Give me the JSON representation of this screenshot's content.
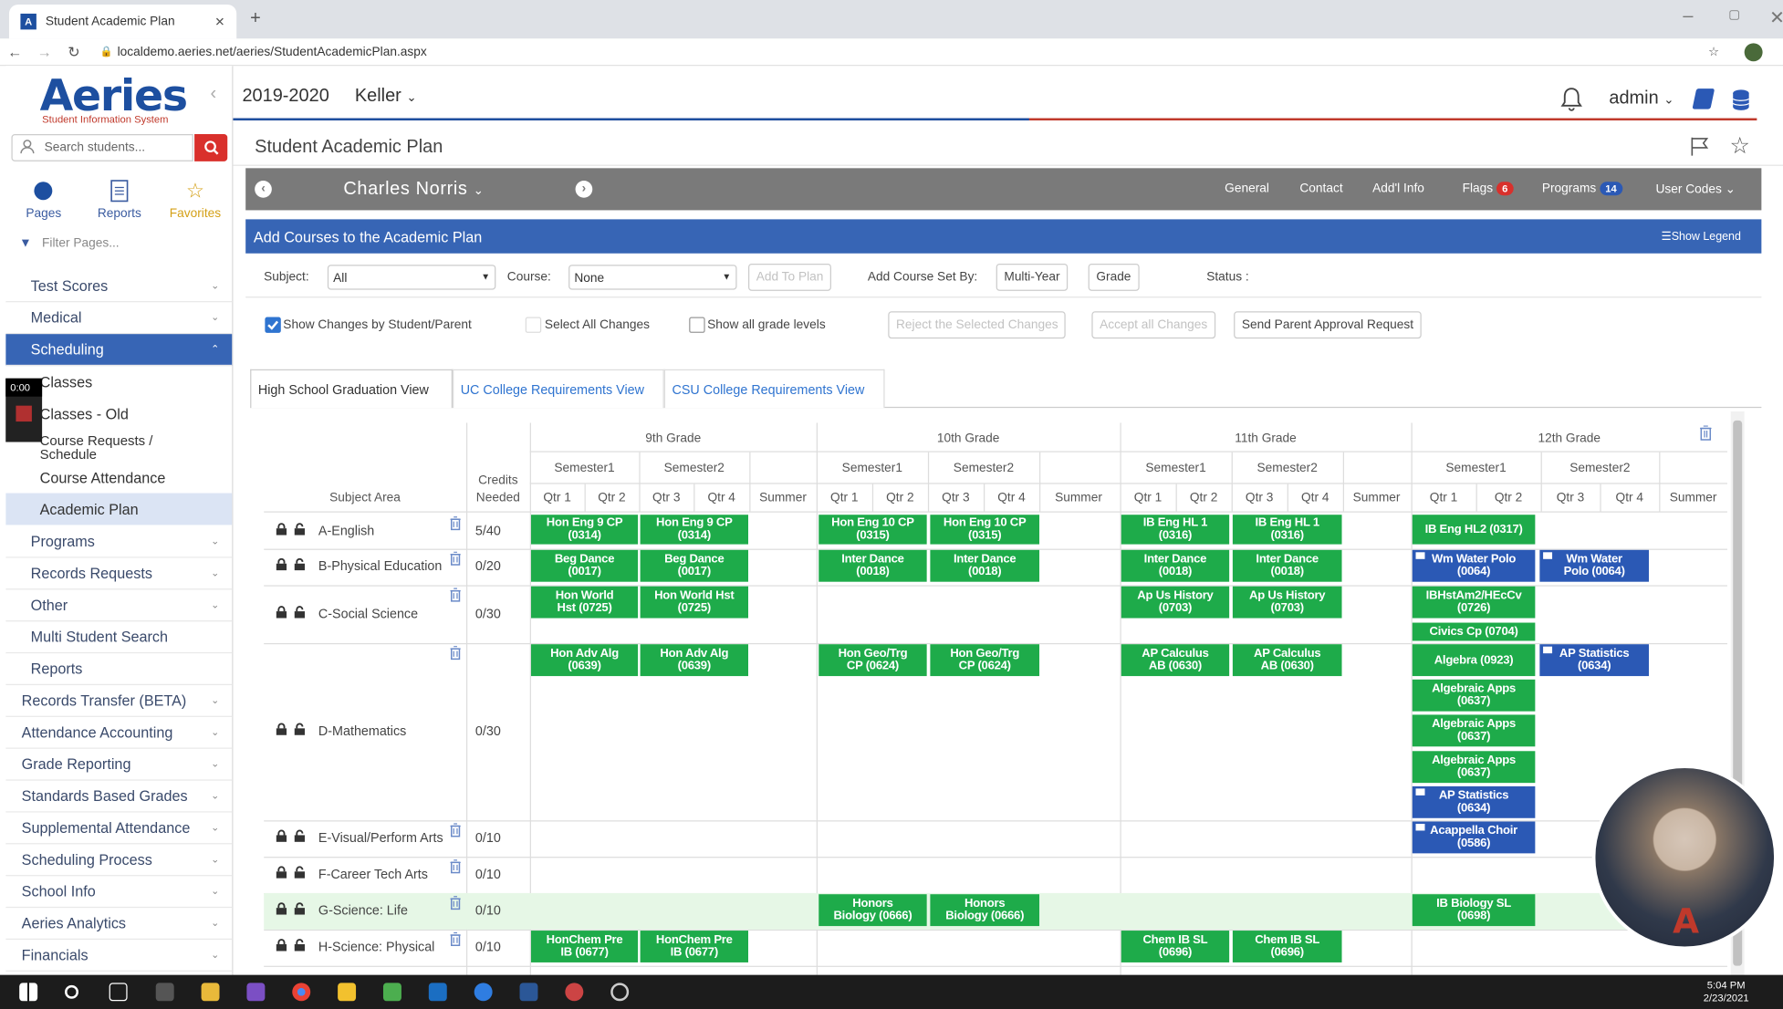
{
  "browser": {
    "tab_title": "Student Academic Plan",
    "url": "localdemo.aeries.net/aeries/StudentAcademicPlan.aspx"
  },
  "sidebar": {
    "logo": "Aeries",
    "logo_sub": "Student Information System",
    "search_placeholder": "Search students...",
    "tabs": [
      "Pages",
      "Reports",
      "Favorites"
    ],
    "filter_placeholder": "Filter Pages...",
    "items": [
      {
        "label": "Test Scores",
        "type": "sec"
      },
      {
        "label": "Medical",
        "type": "sec"
      },
      {
        "label": "Scheduling",
        "type": "active"
      },
      {
        "label": "Classes",
        "type": "sub"
      },
      {
        "label": "Classes - Old",
        "type": "sub"
      },
      {
        "label": "Course Requests / Schedule",
        "type": "sub"
      },
      {
        "label": "Course Attendance",
        "type": "sub"
      },
      {
        "label": "Academic Plan",
        "type": "subsel"
      },
      {
        "label": "Programs",
        "type": "sec"
      },
      {
        "label": "Records Requests",
        "type": "sec"
      },
      {
        "label": "Other",
        "type": "sec"
      },
      {
        "label": "Multi Student Search",
        "type": "plain"
      },
      {
        "label": "Reports",
        "type": "plain"
      },
      {
        "label": "Records Transfer (BETA)",
        "type": "top"
      },
      {
        "label": "Attendance Accounting",
        "type": "top"
      },
      {
        "label": "Grade Reporting",
        "type": "top"
      },
      {
        "label": "Standards Based Grades",
        "type": "top"
      },
      {
        "label": "Supplemental Attendance",
        "type": "top"
      },
      {
        "label": "Scheduling Process",
        "type": "top"
      },
      {
        "label": "School Info",
        "type": "top"
      },
      {
        "label": "Aeries Analytics",
        "type": "top"
      },
      {
        "label": "Financials",
        "type": "top"
      }
    ],
    "rec_time": "0:00"
  },
  "header": {
    "year": "2019-2020",
    "school": "Keller",
    "user": "admin",
    "page_title": "Student Academic Plan"
  },
  "student_bar": {
    "name": "Charles Norris",
    "links": [
      "General",
      "Contact",
      "Add'l Info",
      "Flags",
      "Programs",
      "User Codes"
    ],
    "flags_count": "6",
    "programs_count": "14"
  },
  "add_courses": {
    "title": "Add Courses to the Academic Plan",
    "legend": "Show Legend",
    "subject_label": "Subject:",
    "subject_value": "All",
    "course_label": "Course:",
    "course_value": "None",
    "add_btn": "Add To Plan",
    "set_by_label": "Add Course Set By:",
    "multi_year": "Multi-Year",
    "grade": "Grade",
    "status_label": "Status :"
  },
  "checks": {
    "show_changes": "Show Changes by Student/Parent",
    "select_all": "Select All Changes",
    "show_all_levels": "Show all grade levels",
    "reject": "Reject the Selected Changes",
    "accept": "Accept all Changes",
    "send": "Send Parent Approval Request"
  },
  "view_tabs": [
    "High School Graduation View",
    "UC College Requirements View",
    "CSU College Requirements View"
  ],
  "grid": {
    "subject_header": "Subject Area",
    "credits_header": "Credits\nNeeded",
    "grades": [
      "9th Grade",
      "10th Grade",
      "11th Grade",
      "12th Grade"
    ],
    "semesters": [
      "Semester1",
      "Semester2"
    ],
    "quarters": [
      "Qtr 1",
      "Qtr 2",
      "Qtr 3",
      "Qtr 4"
    ],
    "summer": "Summer",
    "subjects": [
      {
        "name": "A-English",
        "credits": "5/40"
      },
      {
        "name": "B-Physical Education",
        "credits": "0/20"
      },
      {
        "name": "C-Social Science",
        "credits": "0/30"
      },
      {
        "name": "D-Mathematics",
        "credits": "0/30"
      },
      {
        "name": "E-Visual/Perform Arts",
        "credits": "0/10"
      },
      {
        "name": "F-Career Tech Arts",
        "credits": "0/10"
      },
      {
        "name": "G-Science: Life",
        "credits": "0/10"
      },
      {
        "name": "H-Science: Physical",
        "credits": "0/10"
      }
    ],
    "courses": [
      {
        "text": "Hon Eng 9 CP\n(0314)",
        "col": 0,
        "row": 0,
        "color": "g"
      },
      {
        "text": "Hon Eng 9 CP\n(0314)",
        "col": 1,
        "row": 0,
        "color": "g"
      },
      {
        "text": "Hon Eng 10 CP\n(0315)",
        "col": 3,
        "row": 0,
        "color": "g"
      },
      {
        "text": "Hon Eng 10 CP\n(0315)",
        "col": 4,
        "row": 0,
        "color": "g"
      },
      {
        "text": "IB Eng HL 1\n(0316)",
        "col": 6,
        "row": 0,
        "color": "g"
      },
      {
        "text": "IB Eng HL 1\n(0316)",
        "col": 7,
        "row": 0,
        "color": "g"
      },
      {
        "text": "IB Eng HL2 (0317)",
        "col": 9,
        "row": 0,
        "color": "g"
      },
      {
        "text": "Beg Dance\n(0017)",
        "col": 0,
        "row": 1,
        "color": "g"
      },
      {
        "text": "Beg Dance\n(0017)",
        "col": 1,
        "row": 1,
        "color": "g"
      },
      {
        "text": "Inter Dance\n(0018)",
        "col": 3,
        "row": 1,
        "color": "g"
      },
      {
        "text": "Inter Dance\n(0018)",
        "col": 4,
        "row": 1,
        "color": "g"
      },
      {
        "text": "Inter Dance\n(0018)",
        "col": 6,
        "row": 1,
        "color": "g"
      },
      {
        "text": "Inter Dance\n(0018)",
        "col": 7,
        "row": 1,
        "color": "g"
      },
      {
        "text": "Wm Water Polo\n(0064)",
        "col": 9,
        "row": 1,
        "color": "b"
      },
      {
        "text": "Wm Water\nPolo (0064)",
        "col": 10,
        "row": 1,
        "color": "b"
      },
      {
        "text": "Hon World\nHst (0725)",
        "col": 0,
        "row": 2,
        "color": "g"
      },
      {
        "text": "Hon World Hst\n(0725)",
        "col": 1,
        "row": 2,
        "color": "g"
      },
      {
        "text": "Ap Us History\n(0703)",
        "col": 6,
        "row": 2,
        "color": "g"
      },
      {
        "text": "Ap Us History\n(0703)",
        "col": 7,
        "row": 2,
        "color": "g"
      },
      {
        "text": "IBHstAm2/HEcCv\n(0726)",
        "col": 9,
        "row": 2,
        "color": "g"
      },
      {
        "text": "Civics Cp (0704)",
        "col": 9,
        "row": 3,
        "color": "g"
      },
      {
        "text": "Hon Adv Alg\n(0639)",
        "col": 0,
        "row": 4,
        "color": "g"
      },
      {
        "text": "Hon Adv Alg\n(0639)",
        "col": 1,
        "row": 4,
        "color": "g"
      },
      {
        "text": "Hon Geo/Trg\nCP (0624)",
        "col": 3,
        "row": 4,
        "color": "g"
      },
      {
        "text": "Hon Geo/Trg\nCP (0624)",
        "col": 4,
        "row": 4,
        "color": "g"
      },
      {
        "text": "AP Calculus\nAB (0630)",
        "col": 6,
        "row": 4,
        "color": "g"
      },
      {
        "text": "AP Calculus\nAB (0630)",
        "col": 7,
        "row": 4,
        "color": "g"
      },
      {
        "text": "Algebra (0923)",
        "col": 9,
        "row": 4,
        "color": "g"
      },
      {
        "text": "AP Statistics\n(0634)",
        "col": 10,
        "row": 4,
        "color": "b"
      },
      {
        "text": "Algebraic Apps\n(0637)",
        "col": 9,
        "row": 5,
        "color": "g"
      },
      {
        "text": "Algebraic Apps\n(0637)",
        "col": 9,
        "row": 6,
        "color": "g"
      },
      {
        "text": "Algebraic Apps\n(0637)",
        "col": 9,
        "row": 7,
        "color": "g"
      },
      {
        "text": "AP Statistics\n(0634)",
        "col": 9,
        "row": 8,
        "color": "b"
      },
      {
        "text": "Acappella Choir\n(0586)",
        "col": 9,
        "row": 9,
        "color": "b"
      },
      {
        "text": "Honors\nBiology (0666)",
        "col": 3,
        "row": 11,
        "color": "g"
      },
      {
        "text": "Honors\nBiology (0666)",
        "col": 4,
        "row": 11,
        "color": "g"
      },
      {
        "text": "IB Biology SL\n(0698)",
        "col": 9,
        "row": 11,
        "color": "g"
      },
      {
        "text": "HonChem Pre\nIB (0677)",
        "col": 0,
        "row": 12,
        "color": "g"
      },
      {
        "text": "HonChem Pre\nIB (0677)",
        "col": 1,
        "row": 12,
        "color": "g"
      },
      {
        "text": "Chem IB SL\n(0696)",
        "col": 6,
        "row": 12,
        "color": "g"
      },
      {
        "text": "Chem IB SL\n(0696)",
        "col": 7,
        "row": 12,
        "color": "g"
      }
    ]
  },
  "taskbar": {
    "time": "5:04 PM",
    "date": "2/23/2021"
  },
  "colors": {
    "brand": "#1d4fa0",
    "accent": "#3765b5",
    "course_green": "#1eab4a",
    "course_blue": "#2b59b5",
    "red": "#c0392b"
  }
}
